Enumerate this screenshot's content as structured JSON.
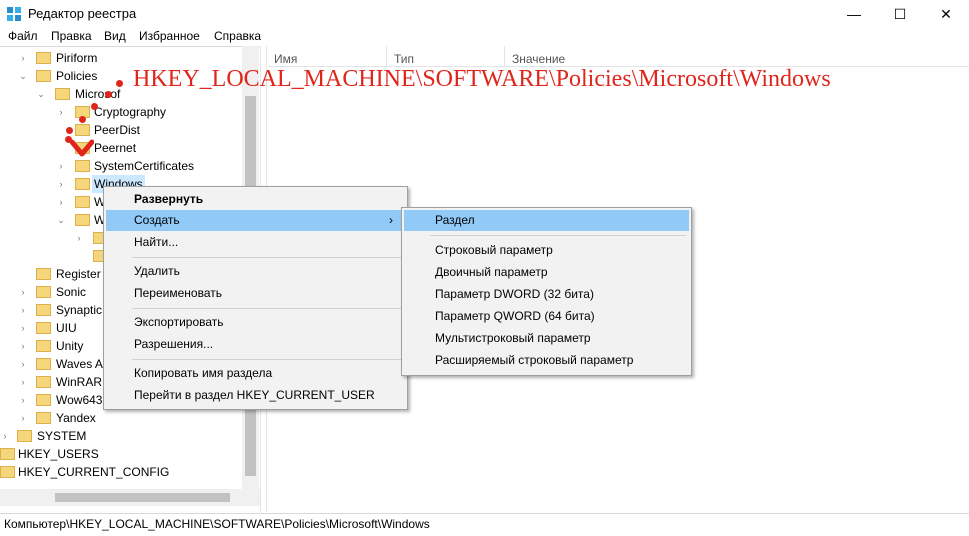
{
  "window": {
    "title": "Редактор реестра",
    "minimize_glyph": "—",
    "maximize_glyph": "☐",
    "close_glyph": "✕"
  },
  "menu": [
    "Файл",
    "Правка",
    "Вид",
    "Избранное",
    "Справка"
  ],
  "tree": [
    {
      "label": "Piriform",
      "arrow": "›"
    },
    {
      "label": "Policies",
      "arrow": "⌄"
    },
    {
      "label": "Microsof",
      "arrow": "⌄"
    },
    {
      "label": "Cryptography",
      "arrow": "›"
    },
    {
      "label": "PeerDist",
      "arrow": ""
    },
    {
      "label": "Peernet",
      "arrow": ""
    },
    {
      "label": "SystemCertificates",
      "arrow": "›"
    },
    {
      "label": "Windows",
      "arrow": "›"
    },
    {
      "label": "W",
      "arrow": "›"
    },
    {
      "label": "W",
      "arrow": "⌄"
    },
    {
      "label": "",
      "arrow": "›"
    },
    {
      "label": "",
      "arrow": ""
    },
    {
      "label": "Register",
      "arrow": ""
    },
    {
      "label": "Sonic",
      "arrow": "›"
    },
    {
      "label": "Synaptic",
      "arrow": "›"
    },
    {
      "label": "UIU",
      "arrow": "›"
    },
    {
      "label": "Unity",
      "arrow": "›"
    },
    {
      "label": "Waves A",
      "arrow": "›"
    },
    {
      "label": "WinRAR",
      "arrow": "›"
    },
    {
      "label": "Wow643",
      "arrow": "›"
    },
    {
      "label": "Yandex",
      "arrow": "›"
    },
    {
      "label": "SYSTEM",
      "arrow": "›"
    },
    {
      "label": "HKEY_USERS",
      "arrow": "›"
    },
    {
      "label": "HKEY_CURRENT_CONFIG",
      "arrow": "›"
    }
  ],
  "list_columns": [
    "Имя",
    "Тип",
    "Значение"
  ],
  "context_menu": {
    "items": [
      "Развернуть",
      "Создать",
      "Найти...",
      "Удалить",
      "Переименовать",
      "Экспортировать",
      "Разрешения...",
      "Копировать имя раздела",
      "Перейти в раздел HKEY_CURRENT_USER"
    ],
    "submenu_arrow": "›"
  },
  "submenu": {
    "items": [
      "Раздел",
      "Строковый параметр",
      "Двоичный параметр",
      "Параметр DWORD (32 бита)",
      "Параметр QWORD (64 бита)",
      "Мультистроковый параметр",
      "Расширяемый строковый параметр"
    ]
  },
  "annotation": "HKEY_LOCAL_MACHINE\\SOFTWARE\\Policies\\Microsoft\\Windows",
  "status": "Компьютер\\HKEY_LOCAL_MACHINE\\SOFTWARE\\Policies\\Microsoft\\Windows",
  "colors": {
    "highlight": "#91c9f7",
    "selection": "#cce8ff",
    "annotation": "#e0251b",
    "folder": "#f6d67a"
  }
}
